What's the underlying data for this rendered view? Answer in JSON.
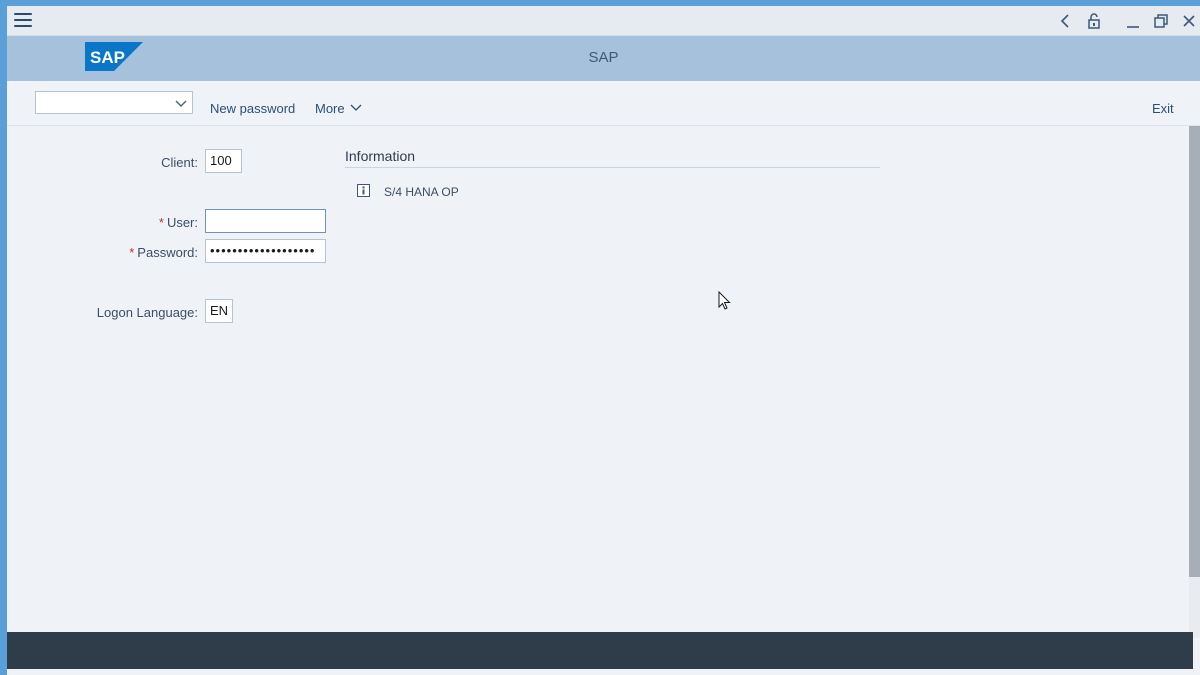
{
  "header": {
    "title": "SAP",
    "logo_text": "SAP",
    "brand_color": "#0a76c8"
  },
  "toolbar": {
    "transaction_field": {
      "value": "",
      "placeholder": ""
    },
    "new_password": "New password",
    "more": "More",
    "exit": "Exit"
  },
  "form": {
    "client": {
      "label": "Client:",
      "value": "100"
    },
    "user": {
      "label": "User:",
      "required": "*",
      "value": ""
    },
    "password": {
      "label": "Password:",
      "required": "*",
      "value": "•••••••••••••••••••"
    },
    "language": {
      "label": "Logon Language:",
      "value": "EN"
    }
  },
  "information": {
    "title": "Information",
    "items": [
      {
        "icon": "info-icon",
        "text": "S/4 HANA OP"
      }
    ]
  },
  "colors": {
    "header_bg": "#a5c1dc",
    "page_bg": "#eff2f7",
    "required": "#c0302b",
    "status_bar": "#2f3d4a"
  }
}
